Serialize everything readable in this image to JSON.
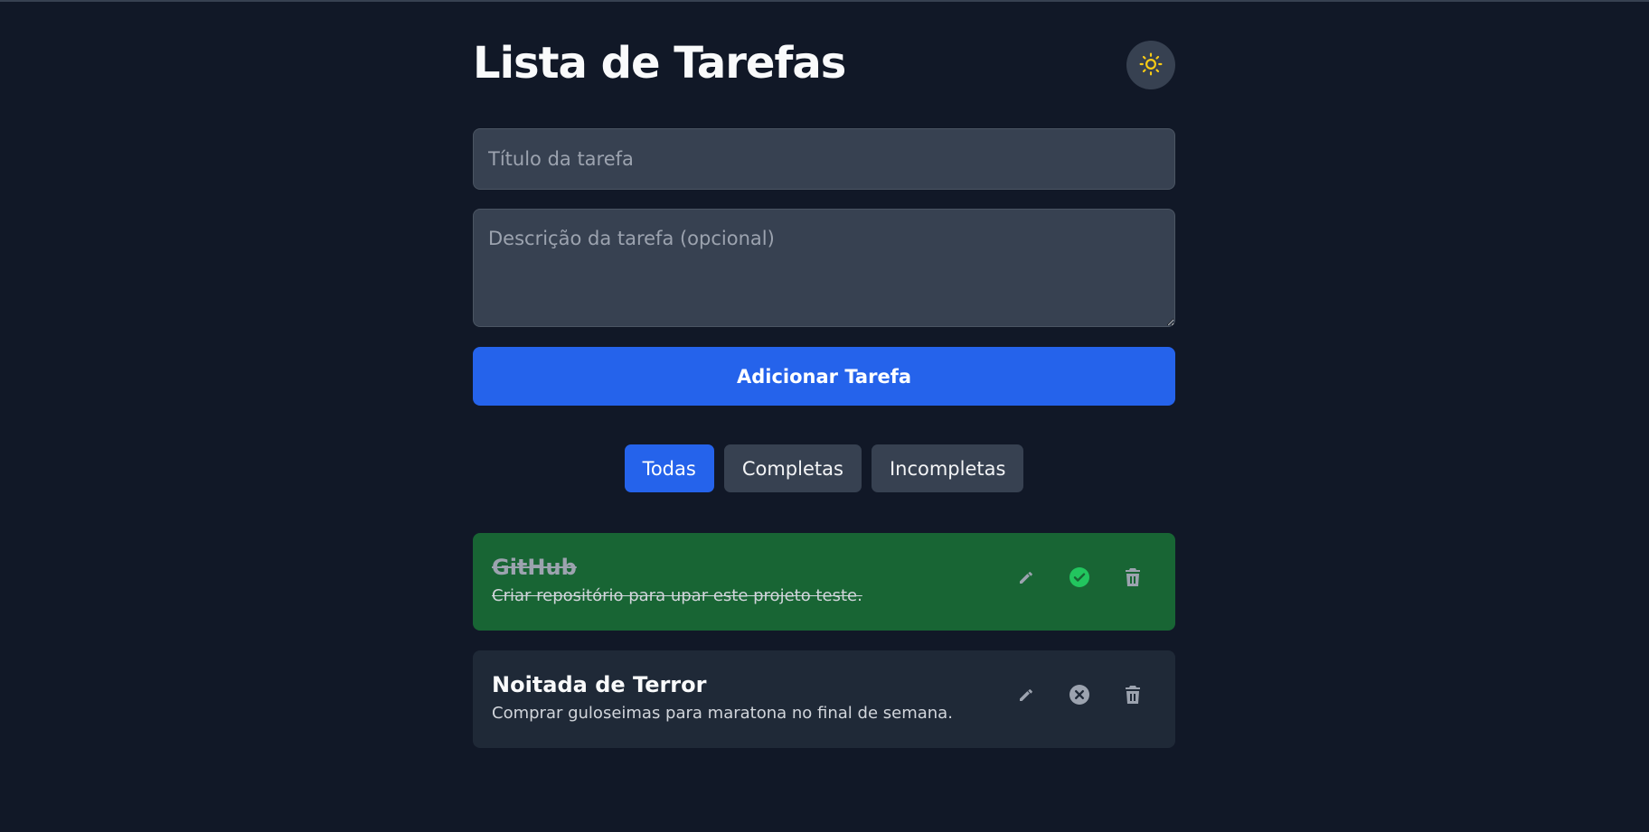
{
  "colors": {
    "background": "#111827",
    "accent": "#2563eb",
    "completed_card": "#186534",
    "open_card": "#1f2937",
    "complete_icon": "#22c55e",
    "sun_icon": "#facc15",
    "muted_icon": "#9ca3af"
  },
  "header": {
    "title": "Lista de Tarefas",
    "theme_icon": "sun-icon"
  },
  "form": {
    "title_placeholder": "Título da tarefa",
    "title_value": "",
    "description_placeholder": "Descrição da tarefa (opcional)",
    "description_value": "",
    "add_label": "Adicionar Tarefa"
  },
  "filters": {
    "active": "Todas",
    "items": [
      {
        "label": "Todas"
      },
      {
        "label": "Completas"
      },
      {
        "label": "Incompletas"
      }
    ]
  },
  "tasks": [
    {
      "title": "GitHub",
      "description": "Criar repositório para upar este projeto teste.",
      "completed": true,
      "icons": [
        "pencil-icon",
        "check-circle-icon",
        "trash-icon"
      ]
    },
    {
      "title": "Noitada de Terror",
      "description": "Comprar guloseimas para maratona no final de semana.",
      "completed": false,
      "icons": [
        "pencil-icon",
        "x-circle-icon",
        "trash-icon"
      ]
    }
  ]
}
